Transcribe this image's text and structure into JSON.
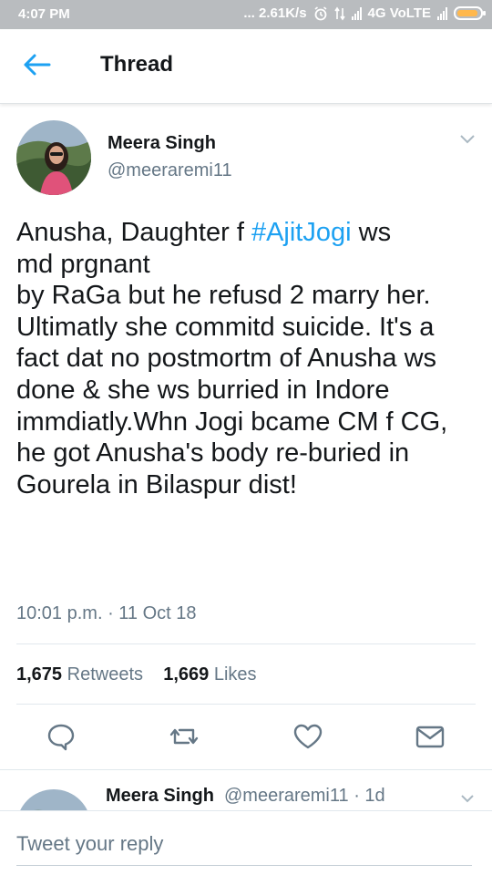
{
  "status_bar": {
    "time": "4:07 PM",
    "speed": "... 2.61K/s",
    "network": "4G VoLTE",
    "battery_color": "#ffb84d"
  },
  "header": {
    "title": "Thread",
    "back_icon": "arrow-left-icon",
    "accent": "#1da1f2"
  },
  "tweet": {
    "author_name": "Meera Singh",
    "author_handle": "@meeraremi11",
    "text_before": "Anusha, Daughter f ",
    "hashtag": "#AjitJogi",
    "text_after": " ws\nmd prgnant\nby RaGa but he refusd 2 marry her. Ultimatly she commitd suicide. It's a fact dat no postmortm of Anusha ws done & she ws burried in Indore immdiatly.Whn Jogi bcame CM f CG, he got Anusha's body  re-buried in Gourela in Bilaspur dist!",
    "time": "10:01 p.m.",
    "date": "11 Oct 18",
    "retweets_count": "1,675",
    "retweets_label": "Retweets",
    "likes_count": "1,669",
    "likes_label": "Likes"
  },
  "actions": [
    "reply-icon",
    "retweet-icon",
    "like-icon",
    "share-icon"
  ],
  "reply_preview": {
    "author_name": "Meera Singh",
    "author_handle": "@meeraremi11 · 1d"
  },
  "composer": {
    "placeholder": "Tweet your reply"
  }
}
